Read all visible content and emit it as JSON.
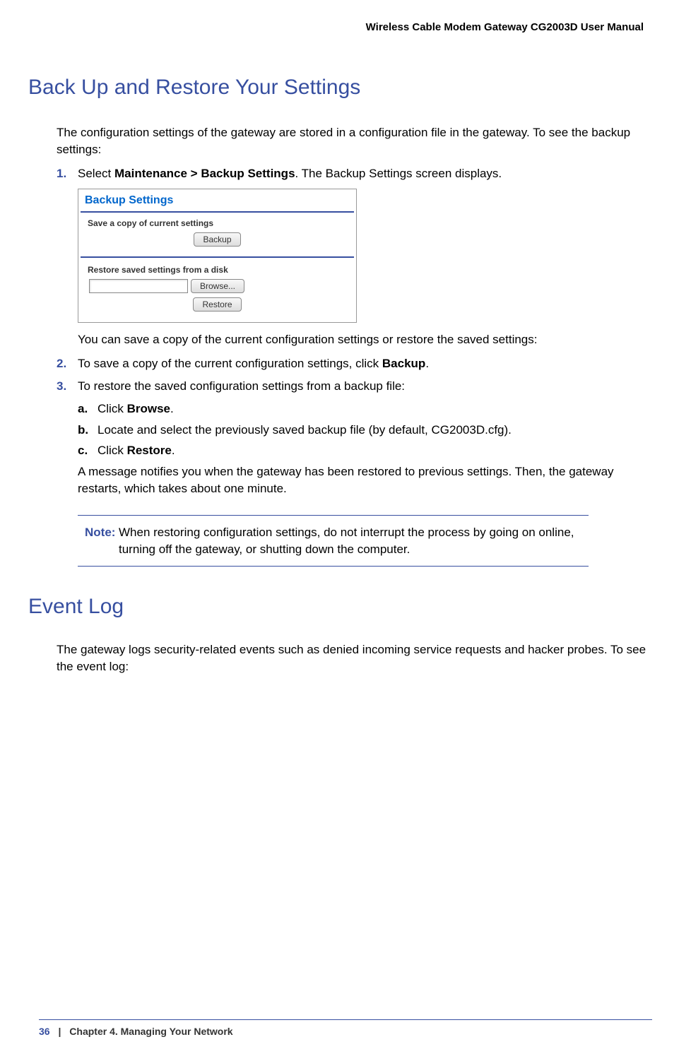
{
  "header": {
    "title": "Wireless Cable Modem Gateway CG2003D User Manual"
  },
  "section1": {
    "heading": "Back Up and Restore Your Settings",
    "intro": "The configuration settings of the gateway are stored in a configuration file in the gateway. To see the backup settings:",
    "step1": {
      "num": "1.",
      "prefix": "Select ",
      "bold": "Maintenance > Backup Settings",
      "suffix": ". The Backup Settings screen displays."
    },
    "screenshot": {
      "title": "Backup Settings",
      "save_label": "Save a copy of current settings",
      "backup_btn": "Backup",
      "restore_label": "Restore saved settings from a disk",
      "browse_btn": "Browse...",
      "restore_btn": "Restore"
    },
    "after_ss": "You can save a copy of the current configuration settings or restore the saved settings:",
    "step2": {
      "num": "2.",
      "prefix": "To save a copy of the current configuration settings, click ",
      "bold": "Backup",
      "suffix": "."
    },
    "step3": {
      "num": "3.",
      "text": "To restore the saved configuration settings from a backup file:"
    },
    "sub_a": {
      "letter": "a.",
      "prefix": "Click ",
      "bold": "Browse",
      "suffix": "."
    },
    "sub_b": {
      "letter": "b.",
      "text": "Locate and select the previously saved backup file (by default, CG2003D.cfg)."
    },
    "sub_c": {
      "letter": "c.",
      "prefix": "Click ",
      "bold": "Restore",
      "suffix": "."
    },
    "after_sub": "A message notifies you when the gateway has been restored to previous settings. Then, the gateway restarts, which takes about one minute.",
    "note": {
      "label": "Note:",
      "text": "When restoring configuration settings, do not interrupt the process by going on online, turning off the gateway, or shutting down the computer."
    }
  },
  "section2": {
    "heading": "Event Log",
    "intro": "The gateway logs security-related events such as denied incoming service requests and hacker probes. To see the event log:"
  },
  "footer": {
    "page": "36",
    "sep": "|",
    "chapter": "Chapter 4.  Managing Your Network"
  }
}
